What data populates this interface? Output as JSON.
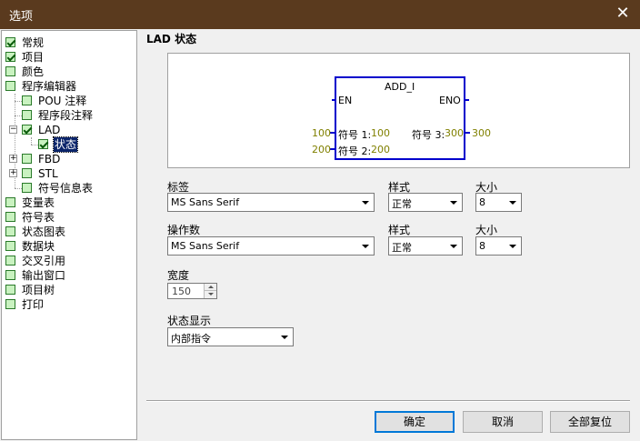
{
  "window": {
    "title": "选项"
  },
  "tree": [
    {
      "label": "常规",
      "checked": true
    },
    {
      "label": "项目",
      "checked": true
    },
    {
      "label": "颜色",
      "checked": false
    },
    {
      "label": "程序编辑器",
      "checked": false
    },
    {
      "label": "POU 注释",
      "checked": false
    },
    {
      "label": "程序段注释",
      "checked": false
    },
    {
      "label": "LAD",
      "checked": true
    },
    {
      "label": "状态",
      "checked": true
    },
    {
      "label": "FBD",
      "checked": false
    },
    {
      "label": "STL",
      "checked": false
    },
    {
      "label": "符号信息表",
      "checked": false
    },
    {
      "label": "变量表",
      "checked": false
    },
    {
      "label": "符号表",
      "checked": false
    },
    {
      "label": "状态图表",
      "checked": false
    },
    {
      "label": "数据块",
      "checked": false
    },
    {
      "label": "交叉引用",
      "checked": false
    },
    {
      "label": "输出窗口",
      "checked": false
    },
    {
      "label": "项目树",
      "checked": false
    },
    {
      "label": "打印",
      "checked": false
    }
  ],
  "section": {
    "title": "LAD 状态"
  },
  "preview": {
    "block_name": "ADD_I",
    "en": "EN",
    "eno": "ENO",
    "in1_value": "100",
    "in1_label": "符号 1:",
    "in1_inner": "100",
    "in2_value": "200",
    "in2_label": "符号 2:",
    "in2_inner": "200",
    "out_label": "符号 3:",
    "out_inner": "300",
    "out_value": "300",
    "colors": {
      "box": "#0000cc",
      "value": "#808000"
    }
  },
  "label_font": {
    "label": "标签",
    "value": "MS Sans Serif"
  },
  "label_style": {
    "label": "样式",
    "value": "正常"
  },
  "label_size": {
    "label": "大小",
    "value": "8"
  },
  "operand_font": {
    "label": "操作数",
    "value": "MS Sans Serif"
  },
  "operand_style": {
    "label": "样式",
    "value": "正常"
  },
  "operand_size": {
    "label": "大小",
    "value": "8"
  },
  "width": {
    "label": "宽度",
    "value": "150"
  },
  "status_display": {
    "label": "状态显示",
    "value": "内部指令"
  },
  "buttons": {
    "ok": "确定",
    "cancel": "取消",
    "reset_all": "全部复位"
  }
}
